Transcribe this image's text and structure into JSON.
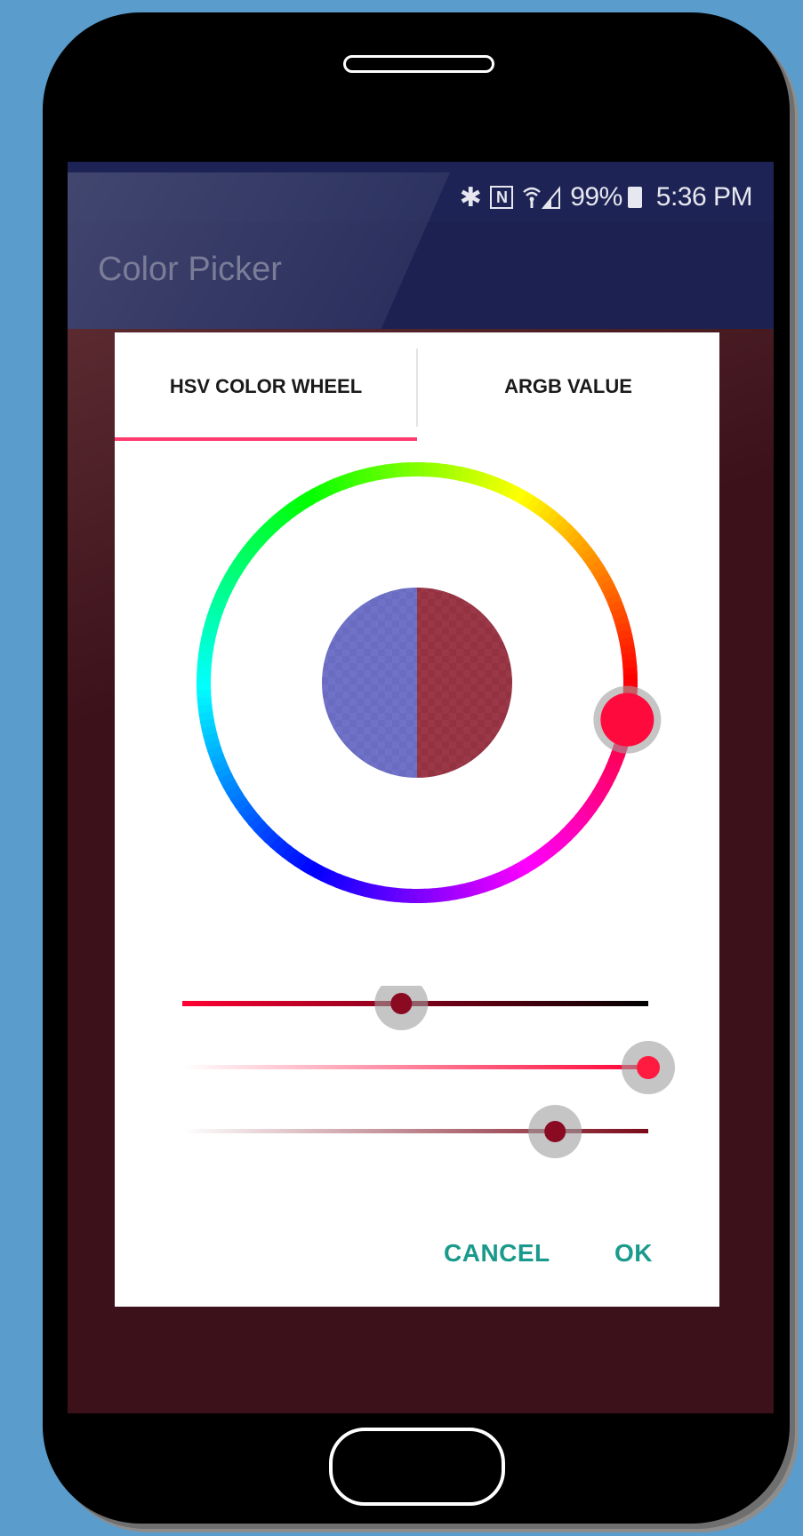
{
  "status_bar": {
    "bluetooth": "✱",
    "nfc": "N",
    "signal": "📶",
    "battery": "99%",
    "time": "5:36 PM"
  },
  "app_bar": {
    "title": "Color Picker"
  },
  "dialog": {
    "tabs": [
      {
        "label": "HSV COLOR WHEEL",
        "selected": true
      },
      {
        "label": "ARGB VALUE",
        "selected": false
      }
    ],
    "hue_wheel": {
      "hue_degrees": 350,
      "selected_color": "#ff0a3c"
    },
    "preview": {
      "old_color": "#5b5fbf",
      "new_color": "#8d1d2f"
    },
    "sliders": [
      {
        "name": "saturation",
        "value": 0.47,
        "start_color": "#ff0033",
        "end_color": "#000000"
      },
      {
        "name": "value",
        "value": 1.0,
        "start_color": "#ffffff",
        "end_color": "#ff0033"
      },
      {
        "name": "alpha",
        "value": 0.8,
        "start_color": "#ffffff",
        "end_color": "#7a0a1a"
      }
    ],
    "cancel_label": "CANCEL",
    "ok_label": "OK"
  },
  "colors": {
    "accent": "#ff3a6e",
    "button_text": "#1a9a8c",
    "app_bar": "#1c2152",
    "scrim": "#3c111a"
  }
}
